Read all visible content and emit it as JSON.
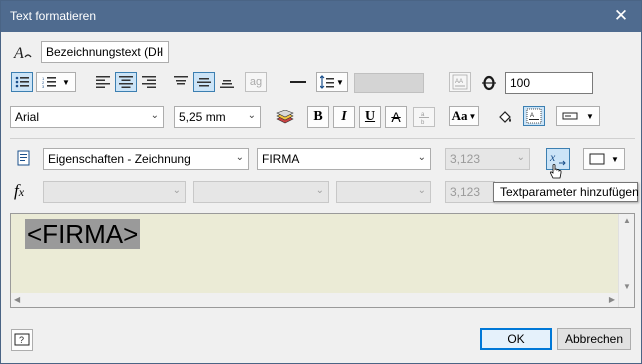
{
  "window": {
    "title": "Text formatieren"
  },
  "row1": {
    "style_value": "Bezeichnungstext (DII",
    "percent_value": "100"
  },
  "row2": {
    "font_value": "Arial",
    "size_value": "5,25 mm"
  },
  "row3": {
    "category_value": "Eigenschaften - Zeichnung",
    "property_value": "FIRMA",
    "precision_value": "3,123"
  },
  "row4": {
    "precision_value": "3,123"
  },
  "editor": {
    "text": "<FIRMA>"
  },
  "tooltip": {
    "text": "Textparameter hinzufügen"
  },
  "buttons": {
    "ok": "OK",
    "cancel": "Abbrechen"
  },
  "icons": {
    "bold": "B",
    "italic": "I",
    "underline": "U",
    "strike": "A",
    "fx": "f",
    "fx_sub": "x"
  }
}
